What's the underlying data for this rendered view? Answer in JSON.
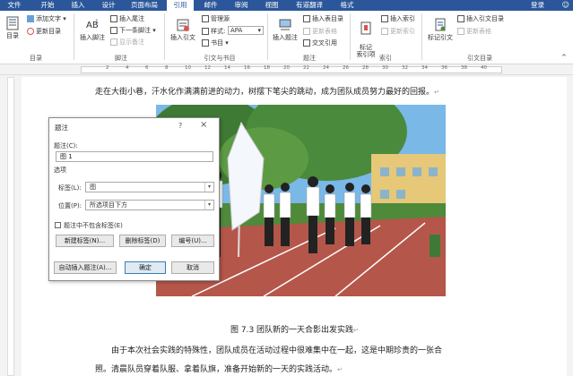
{
  "tabs": [
    "文件",
    "开始",
    "插入",
    "设计",
    "页面布局",
    "引用",
    "邮件",
    "审阅",
    "视图",
    "有道翻译",
    "格式"
  ],
  "active_tab": "引用",
  "login": "登录",
  "ribbon": {
    "toc": {
      "label": "目录",
      "add_text": "添加文字",
      "update_toc": "更新目录",
      "group": "目录"
    },
    "footnote": {
      "insert_footnote": "插入脚注",
      "insert_endnote": "插入尾注",
      "next_footnote": "下一条脚注",
      "show_notes": "显示备注",
      "group": "脚注"
    },
    "citation": {
      "insert_citation": "插入引文",
      "manage_sources": "管理源",
      "style_label": "样式:",
      "style_value": "APA",
      "bibliography": "书目",
      "group": "引文与书目"
    },
    "caption": {
      "insert_caption": "插入题注",
      "insert_table_of_figures": "插入表目录",
      "update_table": "更新表格",
      "cross_reference": "交叉引用",
      "group": "题注"
    },
    "index": {
      "mark_entry": "标记\n索引项",
      "insert_index": "插入索引",
      "update_index": "更新索引",
      "group": "索引"
    },
    "toa": {
      "mark_citation": "标记引文",
      "insert_toa": "插入引文目录",
      "update_table": "更新表格",
      "group": "引文目录"
    }
  },
  "ruler_numbers": [
    "2",
    "4",
    "6",
    "8",
    "10",
    "12",
    "14",
    "16",
    "18",
    "20",
    "22",
    "24",
    "26",
    "28",
    "30",
    "32",
    "34",
    "36",
    "38",
    "40"
  ],
  "document": {
    "line1": "走在大街小巷，汗水化作满满前进的动力，树摆下笔尖的跳动，成为团队成员努力最好的回报。",
    "caption": "图 7.3 团队新的一天合影出发实践",
    "line3": "由于本次社会实践的特殊性，团队成员在活动过程中很难集中在一起，这是中期珍贵的一张合",
    "line4": "照。清晨队员穿着队服、拿着队旗，准备开始新的一天的实践活动。",
    "para_mark": "↵"
  },
  "dialog": {
    "title": "题注",
    "help": "?",
    "close": "×",
    "caption_label": "题注(C):",
    "caption_value": "图 1",
    "options_label": "选项",
    "label_label": "标签(L):",
    "label_value": "图",
    "position_label": "位置(P):",
    "position_value": "所选项目下方",
    "exclude_label": "题注中不包含标签(E)",
    "new_label_btn": "新建标签(N)...",
    "delete_label_btn": "删除标签(D)",
    "numbering_btn": "编号(U)...",
    "autocaption_btn": "自动插入题注(A)...",
    "ok_btn": "确定",
    "cancel_btn": "取消"
  },
  "colors": {
    "accent": "#2b579a",
    "sky": "#7ab8e8",
    "track": "#b5564a",
    "grass": "#4e8a3a"
  }
}
